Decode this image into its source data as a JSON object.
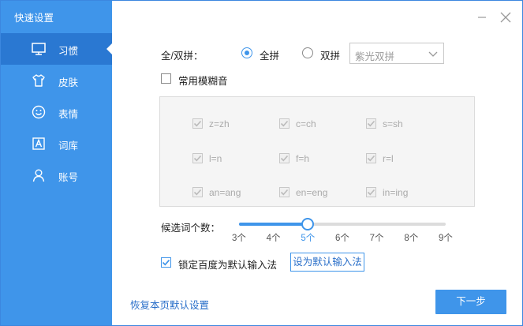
{
  "window": {
    "title": "快速设置",
    "min_icon": "minimize-icon",
    "close_icon": "close-icon"
  },
  "sidebar": {
    "items": [
      {
        "label": "习惯",
        "icon": "monitor-icon",
        "active": true
      },
      {
        "label": "皮肤",
        "icon": "tshirt-icon",
        "active": false
      },
      {
        "label": "表情",
        "icon": "smiley-icon",
        "active": false
      },
      {
        "label": "词库",
        "icon": "lexicon-a-icon",
        "active": false
      },
      {
        "label": "账号",
        "icon": "user-icon",
        "active": false
      }
    ]
  },
  "pinyin": {
    "label": "全/双拼：",
    "options": [
      {
        "label": "全拼",
        "checked": true
      },
      {
        "label": "双拼",
        "checked": false
      }
    ],
    "scheme_value": "紫光双拼"
  },
  "fuzzy": {
    "label": "常用模糊音",
    "checked": false,
    "items": [
      {
        "label": "z=zh",
        "checked": true
      },
      {
        "label": "c=ch",
        "checked": true
      },
      {
        "label": "s=sh",
        "checked": true
      },
      {
        "label": "l=n",
        "checked": true
      },
      {
        "label": "f=h",
        "checked": true
      },
      {
        "label": "r=l",
        "checked": true
      },
      {
        "label": "an=ang",
        "checked": true
      },
      {
        "label": "en=eng",
        "checked": true
      },
      {
        "label": "in=ing",
        "checked": true
      }
    ]
  },
  "candidates": {
    "label": "候选词个数：",
    "ticks": [
      "3个",
      "4个",
      "5个",
      "6个",
      "7个",
      "8个",
      "9个"
    ],
    "selected": "5个",
    "selected_fraction": 0.333
  },
  "default_ime": {
    "lock_label": "锁定百度为默认输入法",
    "lock_checked": true,
    "set_default_button": "设为默认输入法"
  },
  "footer": {
    "restore_link": "恢复本页默认设置",
    "next_button": "下一步"
  },
  "colors": {
    "accent": "#3f95ea",
    "sidebar_active": "#2a78d2",
    "link": "#2a6fc9"
  }
}
